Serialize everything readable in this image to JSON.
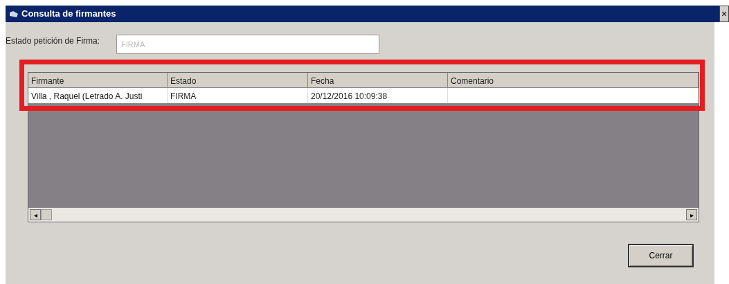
{
  "window": {
    "title": "Consulta de firmantes",
    "close": "×"
  },
  "field": {
    "label": "Estado petición de Firma:",
    "value": "FIRMA",
    "disabled": true
  },
  "table": {
    "columns": [
      "Firmante",
      "Estado",
      "Fecha",
      "Comentario"
    ],
    "rows": [
      {
        "cells": [
          "Villa , Raquel (Letrado A. Justi",
          "FIRMA",
          "20/12/2016 10:09:38"
        ]
      }
    ]
  },
  "scrollbar": {
    "left": "◂",
    "right": "▸"
  },
  "buttons": [
    "Cerrar"
  ]
}
